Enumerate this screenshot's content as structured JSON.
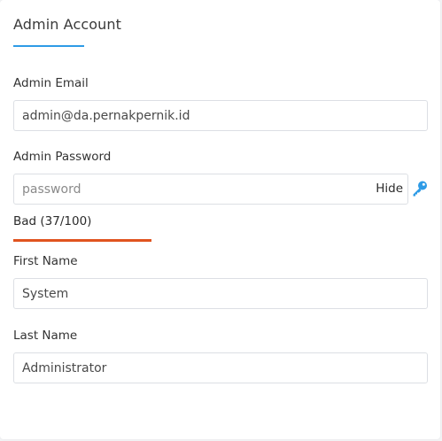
{
  "section": {
    "title": "Admin Account"
  },
  "fields": {
    "email": {
      "label": "Admin Email",
      "value": "admin@da.pernakpernik.id",
      "placeholder": ""
    },
    "password": {
      "label": "Admin Password",
      "value": "",
      "placeholder": "password",
      "toggle_label": "Hide",
      "icon": "key-icon"
    },
    "strength": {
      "text": "Bad (37/100)",
      "score": 37,
      "max": 100,
      "color": "#e0531f"
    },
    "first_name": {
      "label": "First Name",
      "value": "System",
      "placeholder": ""
    },
    "last_name": {
      "label": "Last Name",
      "value": "Administrator",
      "placeholder": ""
    }
  },
  "colors": {
    "accent": "#2e9be6",
    "danger": "#e0531f"
  }
}
